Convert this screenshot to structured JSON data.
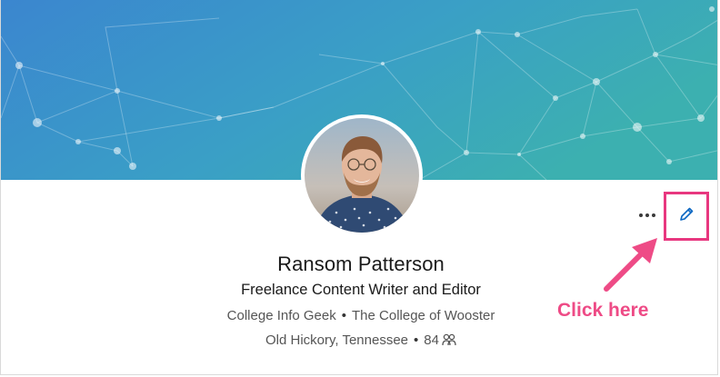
{
  "profile": {
    "name": "Ransom Patterson",
    "headline": "Freelance Content Writer and Editor",
    "company": "College Info Geek",
    "school": "The College of Wooster",
    "location": "Old Hickory, Tennessee",
    "connections": "84",
    "separator": "•"
  },
  "actions": {
    "more_icon": "more-horizontal-icon",
    "edit_icon": "pencil-icon"
  },
  "annotation": {
    "callout_text": "Click here",
    "highlight_color": "#e8377f"
  },
  "colors": {
    "banner_start": "#3c8ed0",
    "banner_end": "#38a9b0",
    "accent_blue": "#0a66c2"
  }
}
